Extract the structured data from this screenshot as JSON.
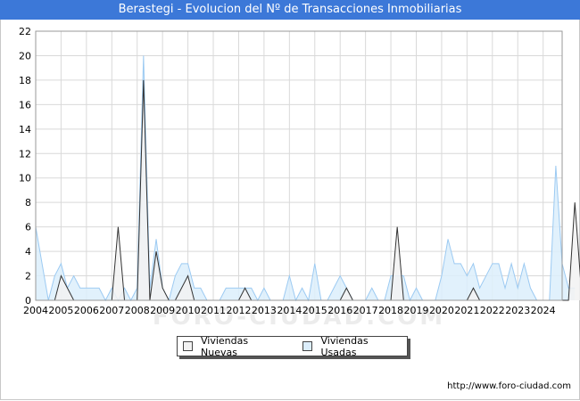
{
  "title": "Berastegi - Evolucion del Nº de Transacciones Inmobiliarias",
  "source_text": "http://www.foro-ciudad.com",
  "watermark_text": "FORO-CIUDAD.COM",
  "colors": {
    "title_bg": "#3c78d8",
    "nuevas_fill": "#f2f2f2",
    "nuevas_line": "#333333",
    "usadas_fill": "#dceefc",
    "usadas_line": "#9ccaf2",
    "grid": "#d9d9d9"
  },
  "chart_data": {
    "type": "area",
    "title": "Berastegi - Evolucion del Nº de Transacciones Inmobiliarias",
    "xlabel": "",
    "ylabel": "",
    "x_start_year": 2004,
    "x_end_year": 2024,
    "x_ticks": [
      "2004",
      "2005",
      "2006",
      "2007",
      "2008",
      "2009",
      "2010",
      "2011",
      "2012",
      "2013",
      "2014",
      "2015",
      "2016",
      "2017",
      "2018",
      "2019",
      "2020",
      "2021",
      "2022",
      "2023",
      "2024"
    ],
    "ylim": [
      0,
      22
    ],
    "y_ticks": [
      0,
      2,
      4,
      6,
      8,
      10,
      12,
      14,
      16,
      18,
      20,
      22
    ],
    "grid": true,
    "legend_position": "bottom-center",
    "series": [
      {
        "name": "Viviendas Nuevas",
        "period": "quarterly",
        "values": [
          0,
          0,
          0,
          0,
          2,
          1,
          0,
          0,
          0,
          0,
          0,
          0,
          0,
          6,
          0,
          0,
          0,
          18,
          0,
          4,
          1,
          0,
          0,
          1,
          2,
          0,
          0,
          0,
          0,
          0,
          0,
          0,
          0,
          1,
          0,
          0,
          0,
          0,
          0,
          0,
          0,
          0,
          0,
          0,
          0,
          0,
          0,
          0,
          0,
          1,
          0,
          0,
          0,
          0,
          0,
          0,
          0,
          6,
          0,
          0,
          0,
          0,
          0,
          0,
          0,
          0,
          0,
          0,
          0,
          1,
          0,
          0,
          0,
          0,
          0,
          0,
          0,
          0,
          0,
          0,
          0,
          0,
          0,
          0,
          0,
          8,
          1,
          0
        ]
      },
      {
        "name": "Viviendas Usadas",
        "period": "quarterly",
        "values": [
          6,
          3,
          0,
          2,
          3,
          1,
          2,
          1,
          1,
          1,
          1,
          0,
          1,
          0,
          1,
          0,
          1,
          20,
          1,
          5,
          1,
          0,
          2,
          3,
          3,
          1,
          1,
          0,
          0,
          0,
          1,
          1,
          1,
          1,
          1,
          0,
          1,
          0,
          0,
          0,
          2,
          0,
          1,
          0,
          3,
          0,
          0,
          1,
          2,
          1,
          0,
          0,
          0,
          1,
          0,
          0,
          2,
          2,
          2,
          0,
          1,
          0,
          0,
          0,
          2,
          5,
          3,
          3,
          2,
          3,
          1,
          2,
          3,
          3,
          1,
          3,
          1,
          3,
          1,
          0,
          0,
          0,
          11,
          3,
          1,
          1
        ]
      }
    ]
  }
}
